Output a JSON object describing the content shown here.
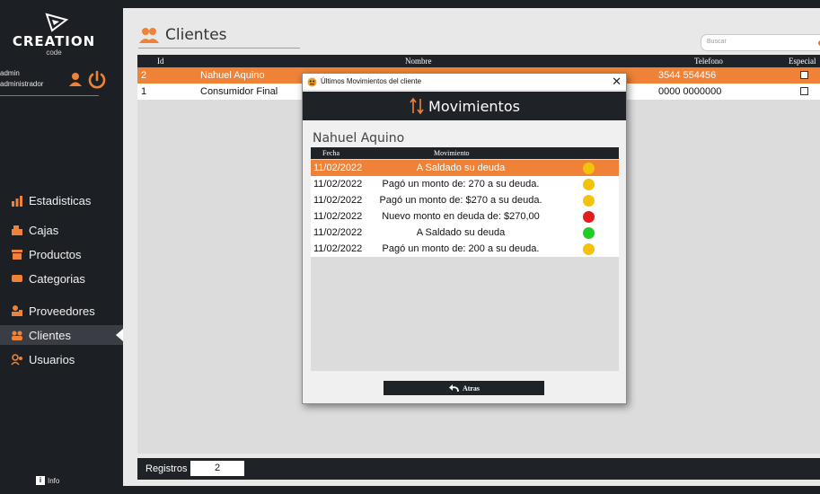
{
  "colors": {
    "accent": "#ef8237",
    "dark": "#1f2227",
    "status_yellow": "#f4c20d",
    "status_red": "#e11d1d",
    "status_green": "#22cc22"
  },
  "sidebar": {
    "logo_text": "CREATION",
    "logo_sub": "code",
    "user_name": "admin",
    "user_role": "administrador",
    "items": [
      {
        "label": "Estadisticas",
        "icon": "bar-chart-icon"
      },
      {
        "label": "Cajas",
        "icon": "cash-register-icon"
      },
      {
        "label": "Productos",
        "icon": "box-icon"
      },
      {
        "label": "Categorias",
        "icon": "tag-icon"
      },
      {
        "label": "Proveedores",
        "icon": "supplier-icon"
      },
      {
        "label": "Clientes",
        "icon": "users-icon",
        "active": true
      },
      {
        "label": "Usuarios",
        "icon": "user-group-icon"
      }
    ],
    "info_label": "Info"
  },
  "main": {
    "title": "Clientes",
    "search_placeholder": "Buscar",
    "columns": [
      "Id",
      "Nombre",
      "Telefono",
      "Especial"
    ],
    "rows": [
      {
        "id": "2",
        "name": "Nahuel Aquino",
        "phone": "3544 554456",
        "special": false,
        "selected": true
      },
      {
        "id": "1",
        "name": "Consumidor Final",
        "phone": "0000 0000000",
        "special": false,
        "selected": false
      }
    ],
    "footer_label": "Registros",
    "footer_value": "2"
  },
  "modal": {
    "window_title": "Últimos Movimientos del cliente",
    "header": "Movimientos",
    "client_name": "Nahuel Aquino",
    "columns": [
      "Fecha",
      "Movimiento"
    ],
    "rows": [
      {
        "date": "11/02/2022",
        "movement": "A Saldado su deuda",
        "status": "yellow",
        "selected": true
      },
      {
        "date": "11/02/2022",
        "movement": "Pagó un monto de: 270 a su deuda.",
        "status": "yellow"
      },
      {
        "date": "11/02/2022",
        "movement": "Pagó un monto de: $270 a su deuda.",
        "status": "yellow"
      },
      {
        "date": "11/02/2022",
        "movement": "Nuevo monto en deuda de: $270,00",
        "status": "red"
      },
      {
        "date": "11/02/2022",
        "movement": "A Saldado su deuda",
        "status": "green"
      },
      {
        "date": "11/02/2022",
        "movement": "Pagó un monto de: 200 a su deuda.",
        "status": "yellow"
      }
    ],
    "back_label": "Atras"
  }
}
